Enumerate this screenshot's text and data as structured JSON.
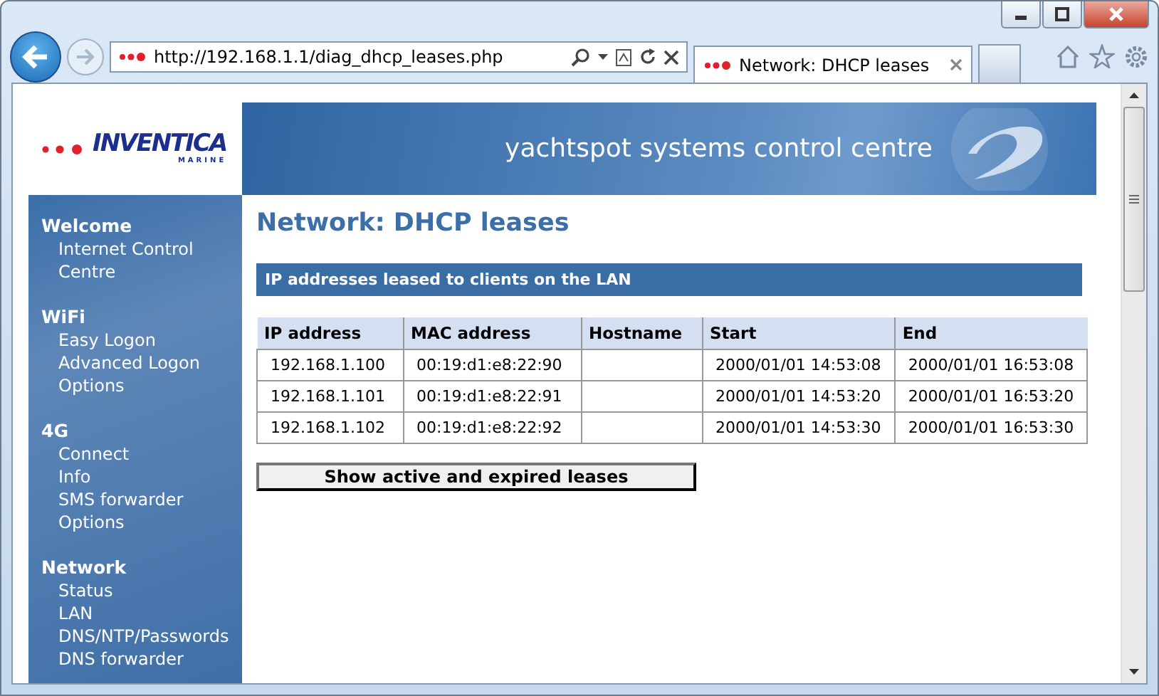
{
  "browser": {
    "address": "http://192.168.1.1/diag_dhcp_leases.php",
    "tab_title": "Network: DHCP leases"
  },
  "logo": {
    "name": "INVENTICA",
    "tagline": "MARINE"
  },
  "banner": {
    "title": "yachtspot systems control centre"
  },
  "sidebar": [
    {
      "heading": "Welcome",
      "items": [
        "Internet Control Centre"
      ]
    },
    {
      "heading": "WiFi",
      "items": [
        "Easy Logon",
        "Advanced Logon",
        "Options"
      ]
    },
    {
      "heading": "4G",
      "items": [
        "Connect",
        "Info",
        "SMS forwarder",
        "Options"
      ]
    },
    {
      "heading": "Network",
      "items": [
        "Status",
        "LAN",
        "DNS/NTP/Passwords",
        "DNS forwarder"
      ]
    }
  ],
  "page_title": "Network: DHCP leases",
  "section_title": "IP addresses leased to clients on the LAN",
  "table": {
    "columns": [
      "IP address",
      "MAC address",
      "Hostname",
      "Start",
      "End"
    ],
    "rows": [
      [
        "192.168.1.100",
        "00:19:d1:e8:22:90",
        "",
        "2000/01/01 14:53:08",
        "2000/01/01 16:53:08"
      ],
      [
        "192.168.1.101",
        "00:19:d1:e8:22:91",
        "",
        "2000/01/01 14:53:20",
        "2000/01/01 16:53:20"
      ],
      [
        "192.168.1.102",
        "00:19:d1:e8:22:92",
        "",
        "2000/01/01 14:53:30",
        "2000/01/01 16:53:30"
      ]
    ]
  },
  "button": "Show active and expired leases"
}
